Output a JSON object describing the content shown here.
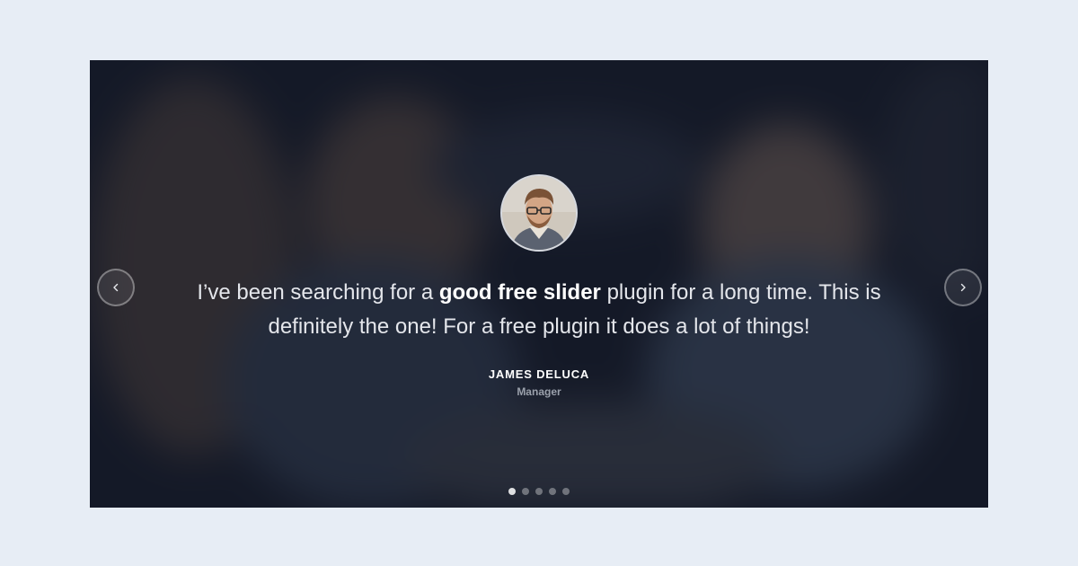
{
  "testimonial": {
    "quote_before": "I’ve been searching for a ",
    "quote_highlight": "good free slider",
    "quote_after": " plugin for a long time. This is definitely the one! For a free plugin it does a lot of things!",
    "name": "JAMES DELUCA",
    "role": "Manager"
  },
  "navigation": {
    "prev_icon": "chevron-left-icon",
    "next_icon": "chevron-right-icon"
  },
  "pagination": {
    "total": 5,
    "active_index": 0
  },
  "colors": {
    "page_background": "#e7edf5",
    "slider_background": "#171c29",
    "text": "#e4e6eb",
    "name": "#ffffff",
    "role": "#9aa0ab"
  }
}
